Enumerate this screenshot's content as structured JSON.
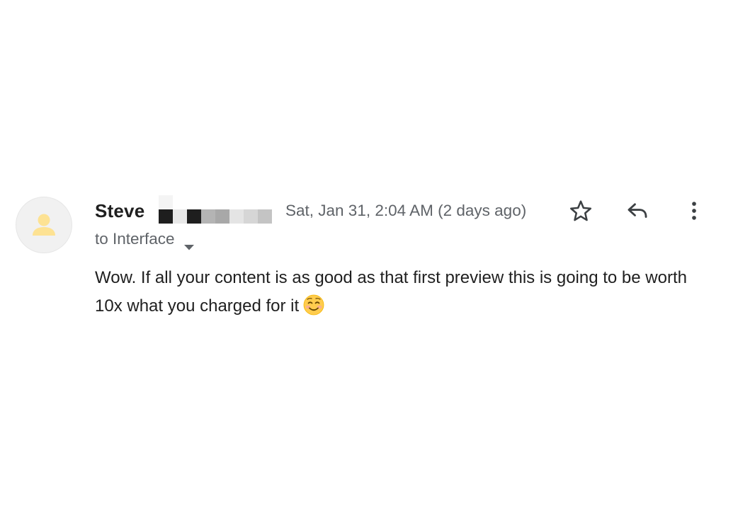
{
  "email": {
    "sender": {
      "name": "Steve",
      "avatar_icon": "person-icon",
      "avatar_colors": {
        "background": "#f1f1f1",
        "figure": "#fde293"
      }
    },
    "timestamp": "Sat, Jan 31, 2:04 AM (2 days ago)",
    "recipient": {
      "text": "to Interface",
      "toggle_icon": "caret-down-icon"
    },
    "actions": {
      "star_icon": "star-icon",
      "reply_icon": "reply-icon",
      "more_icon": "more-vert-icon"
    },
    "body": {
      "text": "Wow. If all your content is as good as that first preview this is going to be worth 10x what you charged for it",
      "emoji_icon": "smiling-face-emoji"
    }
  }
}
